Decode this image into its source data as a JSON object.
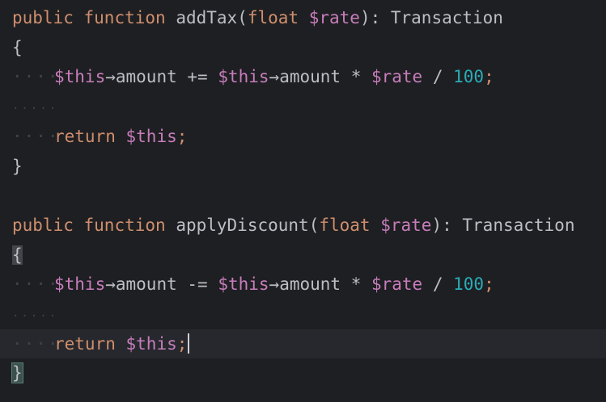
{
  "editor": {
    "lines": [
      {
        "tokens": [
          {
            "t": "public",
            "c": "kw"
          },
          {
            "t": " ",
            "c": "punc"
          },
          {
            "t": "function",
            "c": "kw"
          },
          {
            "t": " ",
            "c": "punc"
          },
          {
            "t": "addTax",
            "c": "fn"
          },
          {
            "t": "(",
            "c": "punc"
          },
          {
            "t": "float",
            "c": "param-type"
          },
          {
            "t": " ",
            "c": "punc"
          },
          {
            "t": "$rate",
            "c": "var"
          },
          {
            "t": "): ",
            "c": "punc"
          },
          {
            "t": "Transaction",
            "c": "type"
          }
        ]
      },
      {
        "tokens": [
          {
            "t": "{",
            "c": "punc"
          }
        ]
      },
      {
        "indent": true,
        "tokens": [
          {
            "t": "$this",
            "c": "var"
          },
          {
            "t": "→",
            "c": "arrow"
          },
          {
            "t": "amount",
            "c": "fn"
          },
          {
            "t": " += ",
            "c": "op"
          },
          {
            "t": "$this",
            "c": "var"
          },
          {
            "t": "→",
            "c": "arrow"
          },
          {
            "t": "amount",
            "c": "fn"
          },
          {
            "t": " * ",
            "c": "op"
          },
          {
            "t": "$rate",
            "c": "var"
          },
          {
            "t": " / ",
            "c": "op"
          },
          {
            "t": "100",
            "c": "num"
          },
          {
            "t": ";",
            "c": "kw"
          }
        ]
      },
      {
        "blank_dots": true,
        "tokens": []
      },
      {
        "indent": true,
        "tokens": [
          {
            "t": "return",
            "c": "kw"
          },
          {
            "t": " ",
            "c": "punc"
          },
          {
            "t": "$this",
            "c": "var"
          },
          {
            "t": ";",
            "c": "kw"
          }
        ]
      },
      {
        "tokens": [
          {
            "t": "}",
            "c": "punc"
          }
        ]
      },
      {
        "tokens": []
      },
      {
        "tokens": [
          {
            "t": "public",
            "c": "kw"
          },
          {
            "t": " ",
            "c": "punc"
          },
          {
            "t": "function",
            "c": "kw"
          },
          {
            "t": " ",
            "c": "punc"
          },
          {
            "t": "applyDiscount",
            "c": "fn"
          },
          {
            "t": "(",
            "c": "punc"
          },
          {
            "t": "float",
            "c": "param-type"
          },
          {
            "t": " ",
            "c": "punc"
          },
          {
            "t": "$rate",
            "c": "var"
          },
          {
            "t": "): ",
            "c": "punc"
          },
          {
            "t": "Transaction",
            "c": "type"
          }
        ]
      },
      {
        "tokens": [
          {
            "t": "{",
            "c": "brace-match"
          }
        ]
      },
      {
        "indent": true,
        "tokens": [
          {
            "t": "$this",
            "c": "var"
          },
          {
            "t": "→",
            "c": "arrow"
          },
          {
            "t": "amount",
            "c": "fn"
          },
          {
            "t": " -= ",
            "c": "op"
          },
          {
            "t": "$this",
            "c": "var"
          },
          {
            "t": "→",
            "c": "arrow"
          },
          {
            "t": "amount",
            "c": "fn"
          },
          {
            "t": " * ",
            "c": "op"
          },
          {
            "t": "$rate",
            "c": "var"
          },
          {
            "t": " / ",
            "c": "op"
          },
          {
            "t": "100",
            "c": "num"
          },
          {
            "t": ";",
            "c": "kw"
          }
        ]
      },
      {
        "blank_dots": true,
        "tokens": []
      },
      {
        "indent": true,
        "current": true,
        "caret": true,
        "tokens": [
          {
            "t": "return",
            "c": "kw"
          },
          {
            "t": " ",
            "c": "punc"
          },
          {
            "t": "$this",
            "c": "var"
          },
          {
            "t": ";",
            "c": "kw"
          }
        ]
      },
      {
        "tokens": [
          {
            "t": "}",
            "c": "brace-match-2"
          }
        ]
      }
    ],
    "indent_marker": "····",
    "blank_marker": "·····"
  },
  "colors": {
    "background": "#1e1f22",
    "keyword": "#cf8e6d",
    "variable": "#c77dbb",
    "number": "#2aacb8",
    "text": "#bcbec4",
    "current_line": "#26282e"
  }
}
